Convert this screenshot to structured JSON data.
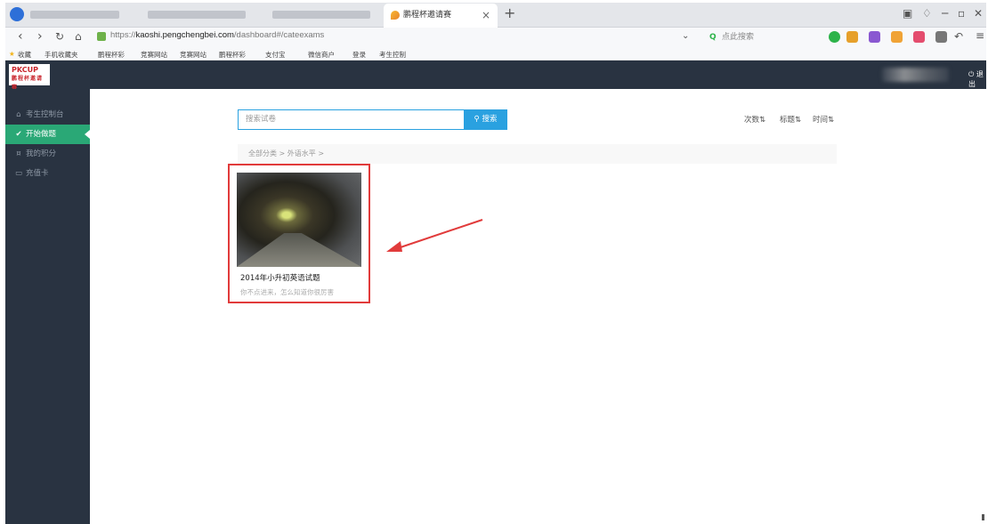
{
  "browser": {
    "tab_title": "鹏程杯邀请赛",
    "close_glyph": "×",
    "newtab_glyph": "+",
    "url_scheme": "https://",
    "url_host": "kaoshi.pengchengbei.com",
    "url_path": "/dashboard#/cateexams",
    "search_placeholder": "点此搜索",
    "bookmarks": [
      "收藏",
      "手机收藏夹",
      "鹏程杯彩",
      "竞赛网站",
      "竞赛网站",
      "鹏程杯彩",
      "支付宝",
      "微信商户",
      "登录",
      "考生控制"
    ]
  },
  "header": {
    "logo_main": "PKCUP",
    "logo_sub": "鹏程杯邀请赛",
    "logout_label": "退出"
  },
  "sidebar": {
    "items": [
      {
        "label": "考生控制台",
        "icon": "home-icon",
        "active": false
      },
      {
        "label": "开始做题",
        "icon": "check-circle-icon",
        "active": true
      },
      {
        "label": "我的积分",
        "icon": "coin-icon",
        "active": false
      },
      {
        "label": "充值卡",
        "icon": "card-icon",
        "active": false
      }
    ]
  },
  "main": {
    "search_placeholder": "搜索试卷",
    "search_button": "搜索",
    "sort": {
      "count": "次数",
      "title": "标题",
      "time": "时间"
    },
    "breadcrumb": "全部分类 > 外语水平 >",
    "exam_card": {
      "title": "2014年小升初英语试题",
      "description": "你不点进来，怎么知道你很厉害"
    }
  },
  "colors": {
    "nav_dark": "#293341",
    "active_green": "#2aa876",
    "primary_blue": "#2aa1e0",
    "highlight_red": "#e13b3b"
  }
}
